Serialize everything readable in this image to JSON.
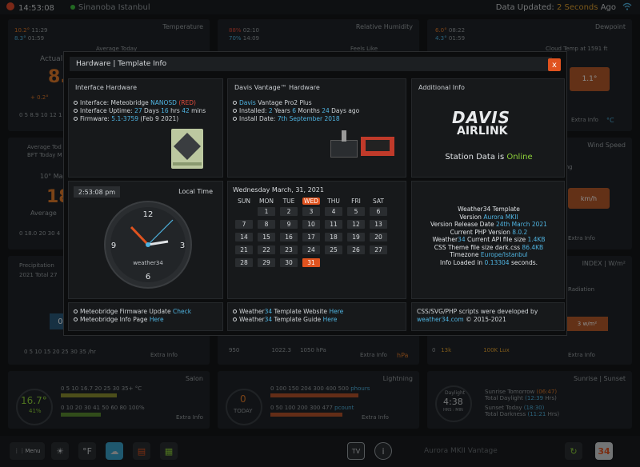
{
  "topbar": {
    "time": "14:53:08",
    "location": "Sinanoba Istanbul",
    "updated_prefix": "Data Updated:",
    "updated_value": "2 Seconds",
    "updated_suffix": "Ago"
  },
  "background": {
    "temperature": {
      "title": "Temperature",
      "hi": "10.2°",
      "hi_time": "11:29",
      "lo": "8.3°",
      "lo_time": "01:59",
      "sub": "Average Today",
      "actual_label": "Actual",
      "value": "8.",
      "trend": "+ 0.2°",
      "scale": "0 5 8.9 10 12 1"
    },
    "humidity": {
      "title": "Relative Humidity",
      "hi": "88%",
      "hi_time": "02:10",
      "lo": "70%",
      "lo_time": "14:09",
      "sub": "Feels Like"
    },
    "dewpoint": {
      "title": "Dewpoint",
      "hi": "6.0°",
      "hi_time": "08:22",
      "lo": "4.3°",
      "lo_time": "01:59",
      "sub": "Cloud Temp at 1591 ft",
      "value": "1.1°",
      "extra": "Extra Info",
      "unit": "°C"
    },
    "wind": {
      "avg": "Average Tod",
      "bft": "BFT Today M",
      "min": "10° Ma",
      "value": "18",
      "avg2": "Average",
      "scale": "0 18.0 20 30 4",
      "title": "Wind Speed",
      "sub": "ting",
      "value2": "km/h",
      "extra": "Extra Info"
    },
    "rain": {
      "title": "Precipitation",
      "total": "2021 Total 27",
      "value": "0.",
      "scale": "0 5 10 15 20 25 30 35 ",
      "unit": "/hr",
      "extra": "Extra Info"
    },
    "uv": {
      "title": "INDEX | W/m²",
      "sub": "Radiation",
      "value": "3 w/m²",
      "extra": "Extra Info",
      "scale_lo": "0",
      "scale_mid": "13k",
      "scale_hi": "100K Lux"
    },
    "pressure": {
      "lo": "950",
      "mid": "1022.3",
      "hi": "1050",
      "unit": "hPa",
      "extra": "Extra Info",
      "unit2": "hPa"
    },
    "salon": {
      "title": "Salon",
      "temp": "16.7°",
      "hum": "41%",
      "scale1": "0 5 10 16.7 20 25 30 35+ °C",
      "scale2": "0 10 20 30 41 50 60 80 100%",
      "extra": "Extra Info"
    },
    "lightning": {
      "title": "Lightning",
      "value": "0",
      "label": "TODAY",
      "scale1": "0 100 150 204 300 400 500",
      "unit1": "phours",
      "scale2": "0 50 100 200 300 477",
      "unit2": "pcount",
      "extra": "Extra Info"
    },
    "sun": {
      "title": "Sunrise | Sunset",
      "daylight": "Daylight",
      "dl_val": "4:38",
      "dl_unit": "HRS : MIN",
      "l1": "Sunrise Tomorrow",
      "l1v": "(06:47)",
      "l2": "Total Daylight",
      "l2v": "(12:39",
      "l2s": "Hrs)",
      "l3": "Sunset Today",
      "l3v": "(18:30)",
      "l4": "Total Darkness",
      "l4v": "(11:21",
      "l4s": "Hrs)"
    }
  },
  "bottombar": {
    "menu": "Menu",
    "f_label": "°F",
    "tv_label": "TV",
    "info_label": "i",
    "footer": "Aurora MKII Vantage",
    "cal_num": "34"
  },
  "modal": {
    "title": "Hardware | Template Info",
    "close": "x",
    "interface": {
      "header": "Interface Hardware",
      "l1_label": "Interface: Meteobridge",
      "l1_model": "NANOSD",
      "l1_tag": "(RED)",
      "l2_label": "Interface Uptime:",
      "l2_days": "27",
      "l2_d": "Days",
      "l2_hrs": "16",
      "l2_h": "hrs",
      "l2_mins": "42",
      "l2_m": "mins",
      "l3_label": "Firmware:",
      "l3_ver": "5.1-3759",
      "l3_date": "(Feb 9 2021)"
    },
    "davis": {
      "header": "Davis Vantage™ Hardware",
      "l1_brand": "Davis",
      "l1_model": "Vantage Pro2 Plus",
      "l2_label": "Installed:",
      "l2_y": "2",
      "l2_yl": "Years",
      "l2_m": "6",
      "l2_ml": "Months",
      "l2_d": "24",
      "l2_dl": "Days ago",
      "l3_label": "Install Date:",
      "l3_date": "7th September 2018"
    },
    "additional": {
      "header": "Additional Info",
      "logo_top": "DAVIS",
      "logo_bottom": "AIRLINK",
      "status_prefix": "Station Data is",
      "status_value": "Online"
    },
    "clock": {
      "digital": "2:53:08 pm",
      "label": "Local Time",
      "n12": "12",
      "n3": "3",
      "n6": "6",
      "n9": "9",
      "brand": "weather34"
    },
    "calendar": {
      "title": "Wednesday March, 31, 2021",
      "days": [
        "SUN",
        "MON",
        "TUE",
        "WED",
        "THU",
        "FRI",
        "SAT"
      ],
      "weeks": [
        [
          "",
          "1",
          "2",
          "3",
          "4",
          "5",
          "6"
        ],
        [
          "7",
          "8",
          "9",
          "10",
          "11",
          "12",
          "13"
        ],
        [
          "14",
          "15",
          "16",
          "17",
          "18",
          "19",
          "20"
        ],
        [
          "21",
          "22",
          "23",
          "24",
          "25",
          "26",
          "27"
        ],
        [
          "28",
          "29",
          "30",
          "31",
          "",
          "",
          ""
        ]
      ],
      "today": "31"
    },
    "template": {
      "l1": "Weather34 Template",
      "l2_label": "Version",
      "l2_val": "Aurora MKII",
      "l3_label": "Version Release Date",
      "l3_val": "24th March 2021",
      "l4_label": "Current PHP Version",
      "l4_val": "8.0.2",
      "l5_a": "Weather",
      "l5_b": "34",
      "l5_c": "Current API file size",
      "l5_val": "1.4KB",
      "l6_label": "CSS Theme file size dark.css",
      "l6_val": "86.4KB",
      "l7_label": "Timezone",
      "l7_val": "Europe/Istanbul",
      "l8_label": "Info Loaded in",
      "l8_val": "0.13304",
      "l8_suffix": "seconds."
    },
    "footer1": {
      "l1_label": "Meteobridge Firmware Update",
      "l1_link": "Check",
      "l2_label": "Meteobridge Info Page",
      "l2_link": "Here"
    },
    "footer2": {
      "l1_a": "Weather",
      "l1_b": "34",
      "l1_c": "Template Website",
      "l1_link": "Here",
      "l2_a": "Weather",
      "l2_b": "34",
      "l2_c": "Template Guide",
      "l2_link": "Here"
    },
    "footer3": {
      "l1": "CSS/SVG/PHP scripts were developed by",
      "l2_link": "weather34.com",
      "l2_suffix": "© 2015-2021"
    }
  },
  "colors": {
    "accent": "#e0531f",
    "blue": "#4fb3e0",
    "green": "#8ed13a",
    "red": "#e04a3a"
  }
}
